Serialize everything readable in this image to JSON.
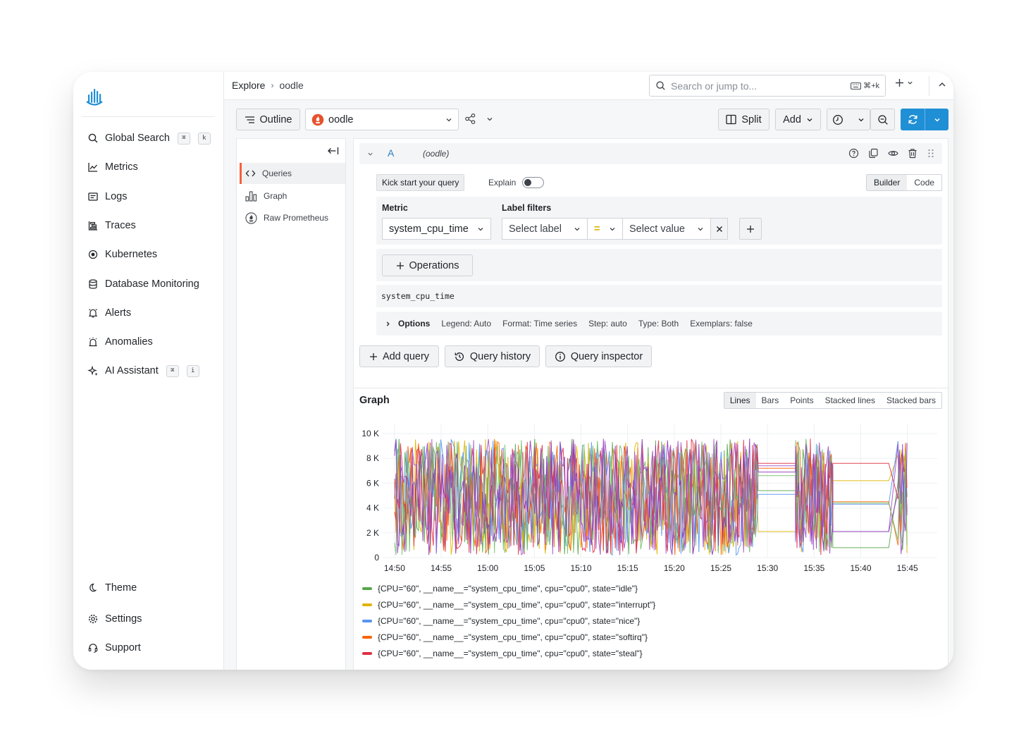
{
  "sidebar": {
    "items": [
      {
        "label": "Global Search",
        "kbd": [
          "⌘",
          "k"
        ]
      },
      {
        "label": "Metrics"
      },
      {
        "label": "Logs"
      },
      {
        "label": "Traces"
      },
      {
        "label": "Kubernetes"
      },
      {
        "label": "Database Monitoring"
      },
      {
        "label": "Alerts"
      },
      {
        "label": "Anomalies"
      },
      {
        "label": "AI Assistant",
        "kbd": [
          "⌘",
          "i"
        ]
      }
    ],
    "bottom": [
      {
        "label": "Theme"
      },
      {
        "label": "Settings"
      },
      {
        "label": "Support"
      }
    ]
  },
  "topbar": {
    "breadcrumb": [
      "Explore",
      "oodle"
    ],
    "search_placeholder": "Search or jump to...",
    "search_hint": "⌘+k"
  },
  "toolbar": {
    "outline_label": "Outline",
    "datasource": "oodle",
    "split_label": "Split",
    "add_label": "Add"
  },
  "outline": {
    "items": [
      "Queries",
      "Graph",
      "Raw Prometheus"
    ]
  },
  "query": {
    "name": "A",
    "datasource": "(oodle)",
    "kick_start": "Kick start your query",
    "explain": "Explain",
    "modes": [
      "Builder",
      "Code"
    ],
    "metric_label": "Metric",
    "metric_value": "system_cpu_time",
    "label_filters_label": "Label filters",
    "select_label": "Select label",
    "operator": "=",
    "select_value": "Select value",
    "operations_label": "Operations",
    "raw_query": "system_cpu_time",
    "options_title": "Options",
    "options": [
      "Legend: Auto",
      "Format: Time series",
      "Step: auto",
      "Type: Both",
      "Exemplars: false"
    ],
    "add_query": "Add query",
    "query_history": "Query history",
    "query_inspector": "Query inspector"
  },
  "graph": {
    "title": "Graph",
    "modes": [
      "Lines",
      "Bars",
      "Points",
      "Stacked lines",
      "Stacked bars"
    ],
    "active_mode": "Lines"
  },
  "colors": {
    "accent": "#1f8fd6",
    "brand": "#f55f3e"
  },
  "chart_data": {
    "type": "line",
    "title": "",
    "xlabel": "",
    "ylabel": "",
    "x_ticks": [
      "14:50",
      "14:55",
      "15:00",
      "15:05",
      "15:10",
      "15:15",
      "15:20",
      "15:25",
      "15:30",
      "15:35",
      "15:40",
      "15:45"
    ],
    "y_ticks": [
      "0",
      "2 K",
      "4 K",
      "6 K",
      "8 K",
      "10 K"
    ],
    "ylim": [
      0,
      10000
    ],
    "xlim": [
      "14:50",
      "15:45"
    ],
    "grid": true,
    "legend_position": "bottom",
    "series": [
      {
        "name": "{CPU=\"60\", __name__=\"system_cpu_time\", cpu=\"cpu0\", state=\"idle\"}",
        "color": "#56a64b",
        "flat_value_1": 5400,
        "flat_value_2": 800
      },
      {
        "name": "{CPU=\"60\", __name__=\"system_cpu_time\", cpu=\"cpu0\", state=\"interrupt\"}",
        "color": "#e0b400",
        "flat_value_1": 2100,
        "flat_value_2": 6200
      },
      {
        "name": "{CPU=\"60\", __name__=\"system_cpu_time\", cpu=\"cpu0\", state=\"nice\"}",
        "color": "#5794f2",
        "flat_value_1": 5100,
        "flat_value_2": 4300
      },
      {
        "name": "{CPU=\"60\", __name__=\"system_cpu_time\", cpu=\"cpu0\", state=\"softirq\"}",
        "color": "#fa6400",
        "flat_value_1": 7200,
        "flat_value_2": 4500
      },
      {
        "name": "{CPU=\"60\", __name__=\"system_cpu_time\", cpu=\"cpu0\", state=\"steal\"}",
        "color": "#e02f44",
        "flat_value_1": 7600,
        "flat_value_2": 7600
      },
      {
        "name": "",
        "color": "#a352cc",
        "flat_value_1": 7400,
        "flat_value_2": 2100
      },
      {
        "name": "",
        "color": "#73bf69",
        "flat_value_1": 6600,
        "flat_value_2": 4400
      },
      {
        "name": "",
        "color": "#8f3bb8",
        "flat_value_1": 6900,
        "flat_value_2": 2100
      }
    ],
    "segments": [
      {
        "type": "noisy",
        "from": "14:50",
        "to": "15:29"
      },
      {
        "type": "flat",
        "from": "15:29",
        "to": "15:33"
      },
      {
        "type": "noisy",
        "from": "15:33",
        "to": "15:37"
      },
      {
        "type": "flat",
        "from": "15:37",
        "to": "15:43"
      },
      {
        "type": "noisy",
        "from": "15:44",
        "to": "15:45"
      }
    ]
  }
}
